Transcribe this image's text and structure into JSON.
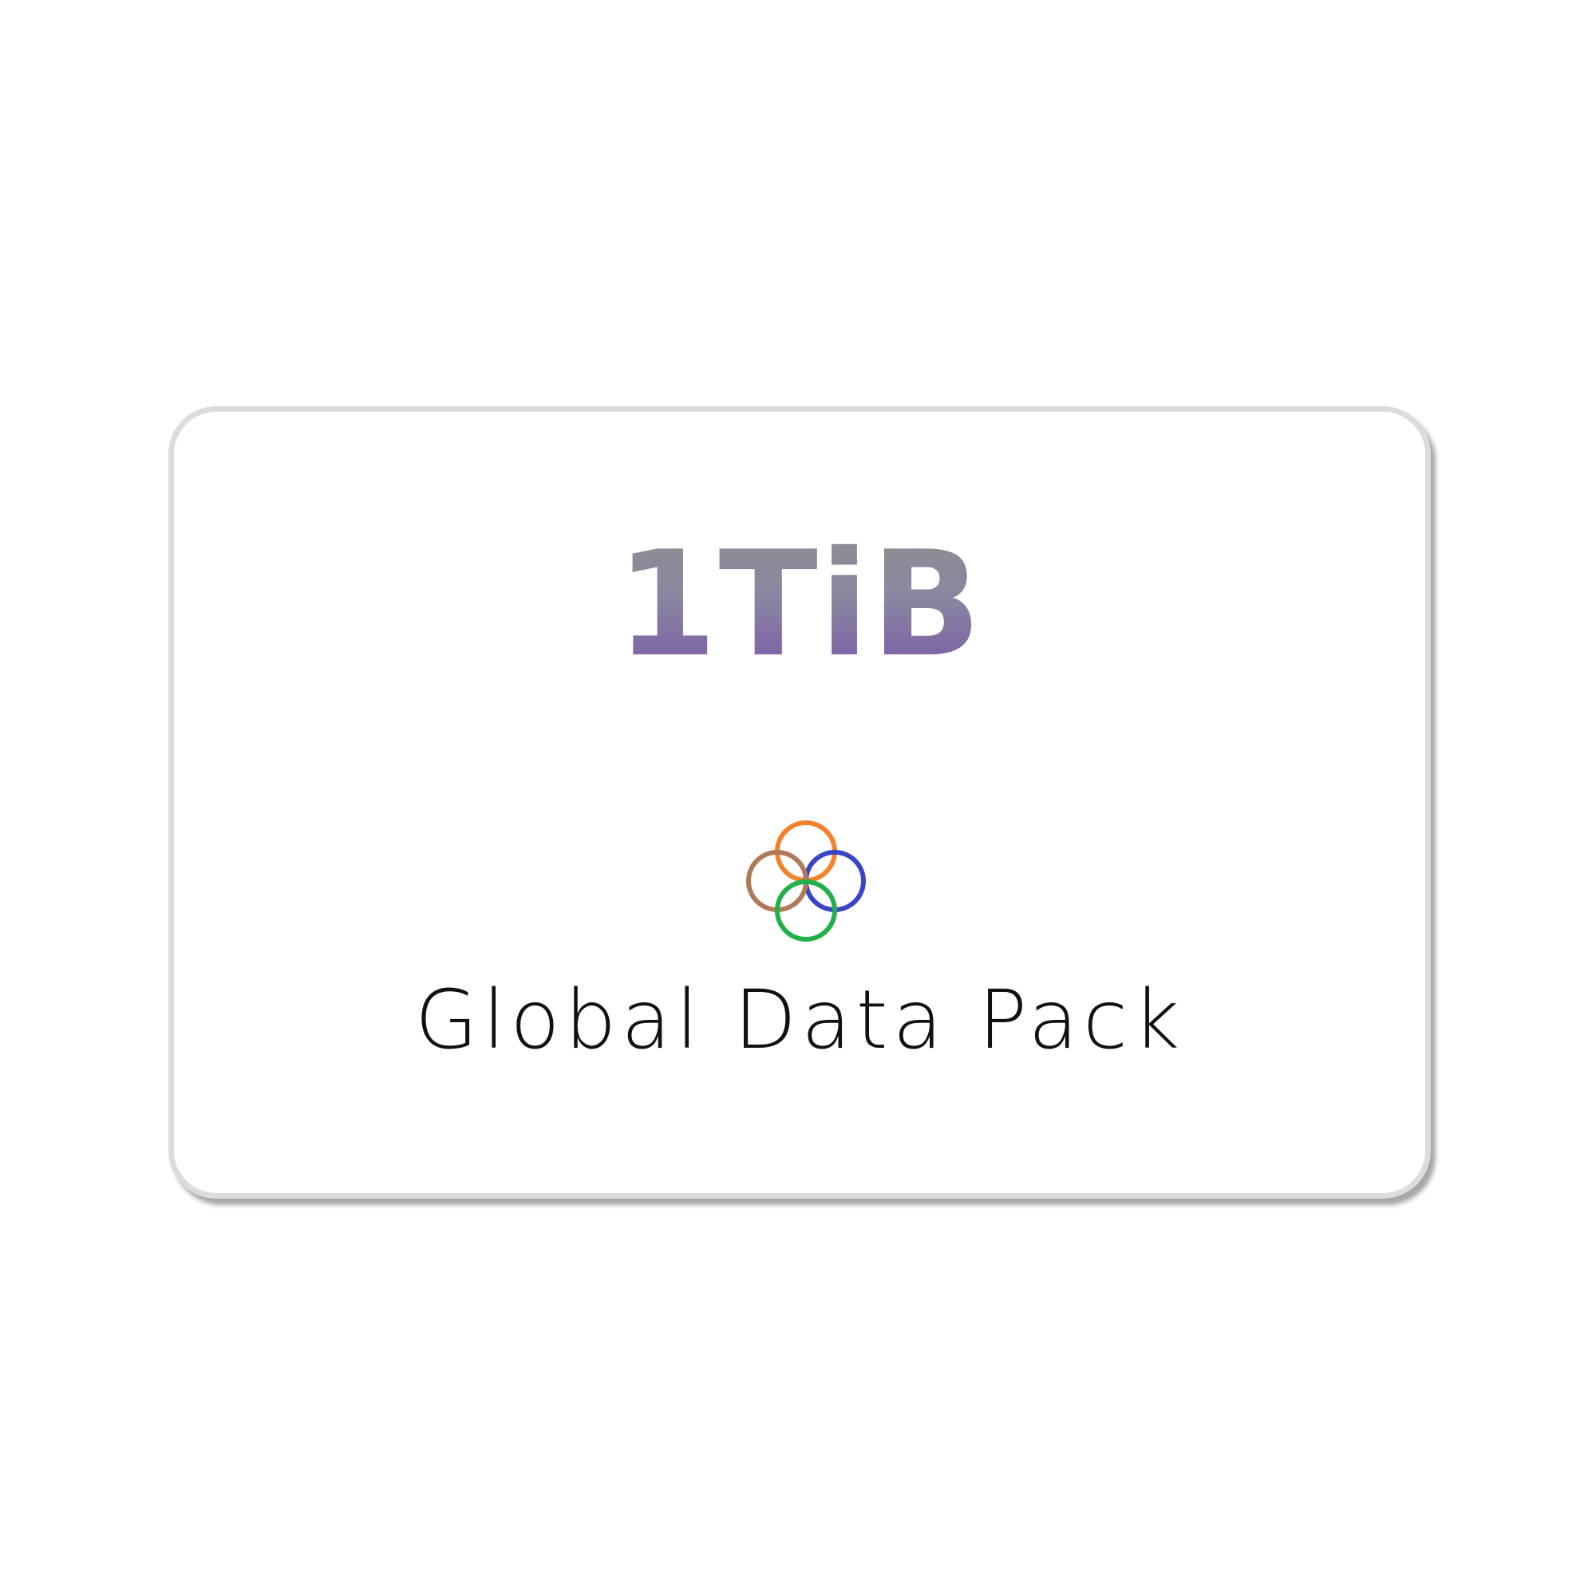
{
  "card": {
    "amount": "1TiB",
    "product_name": "Global Data Pack",
    "logo": {
      "icon": "four-interlocking-rings-logo",
      "ring_colors": [
        "#f4822b",
        "#3b44c4",
        "#b07a58",
        "#22b04a"
      ]
    },
    "colors": {
      "amount_gradient_top": "#8e8e93",
      "amount_gradient_bottom": "#7a5aa8",
      "border": "#dcdcdc",
      "text": "#111111"
    }
  }
}
